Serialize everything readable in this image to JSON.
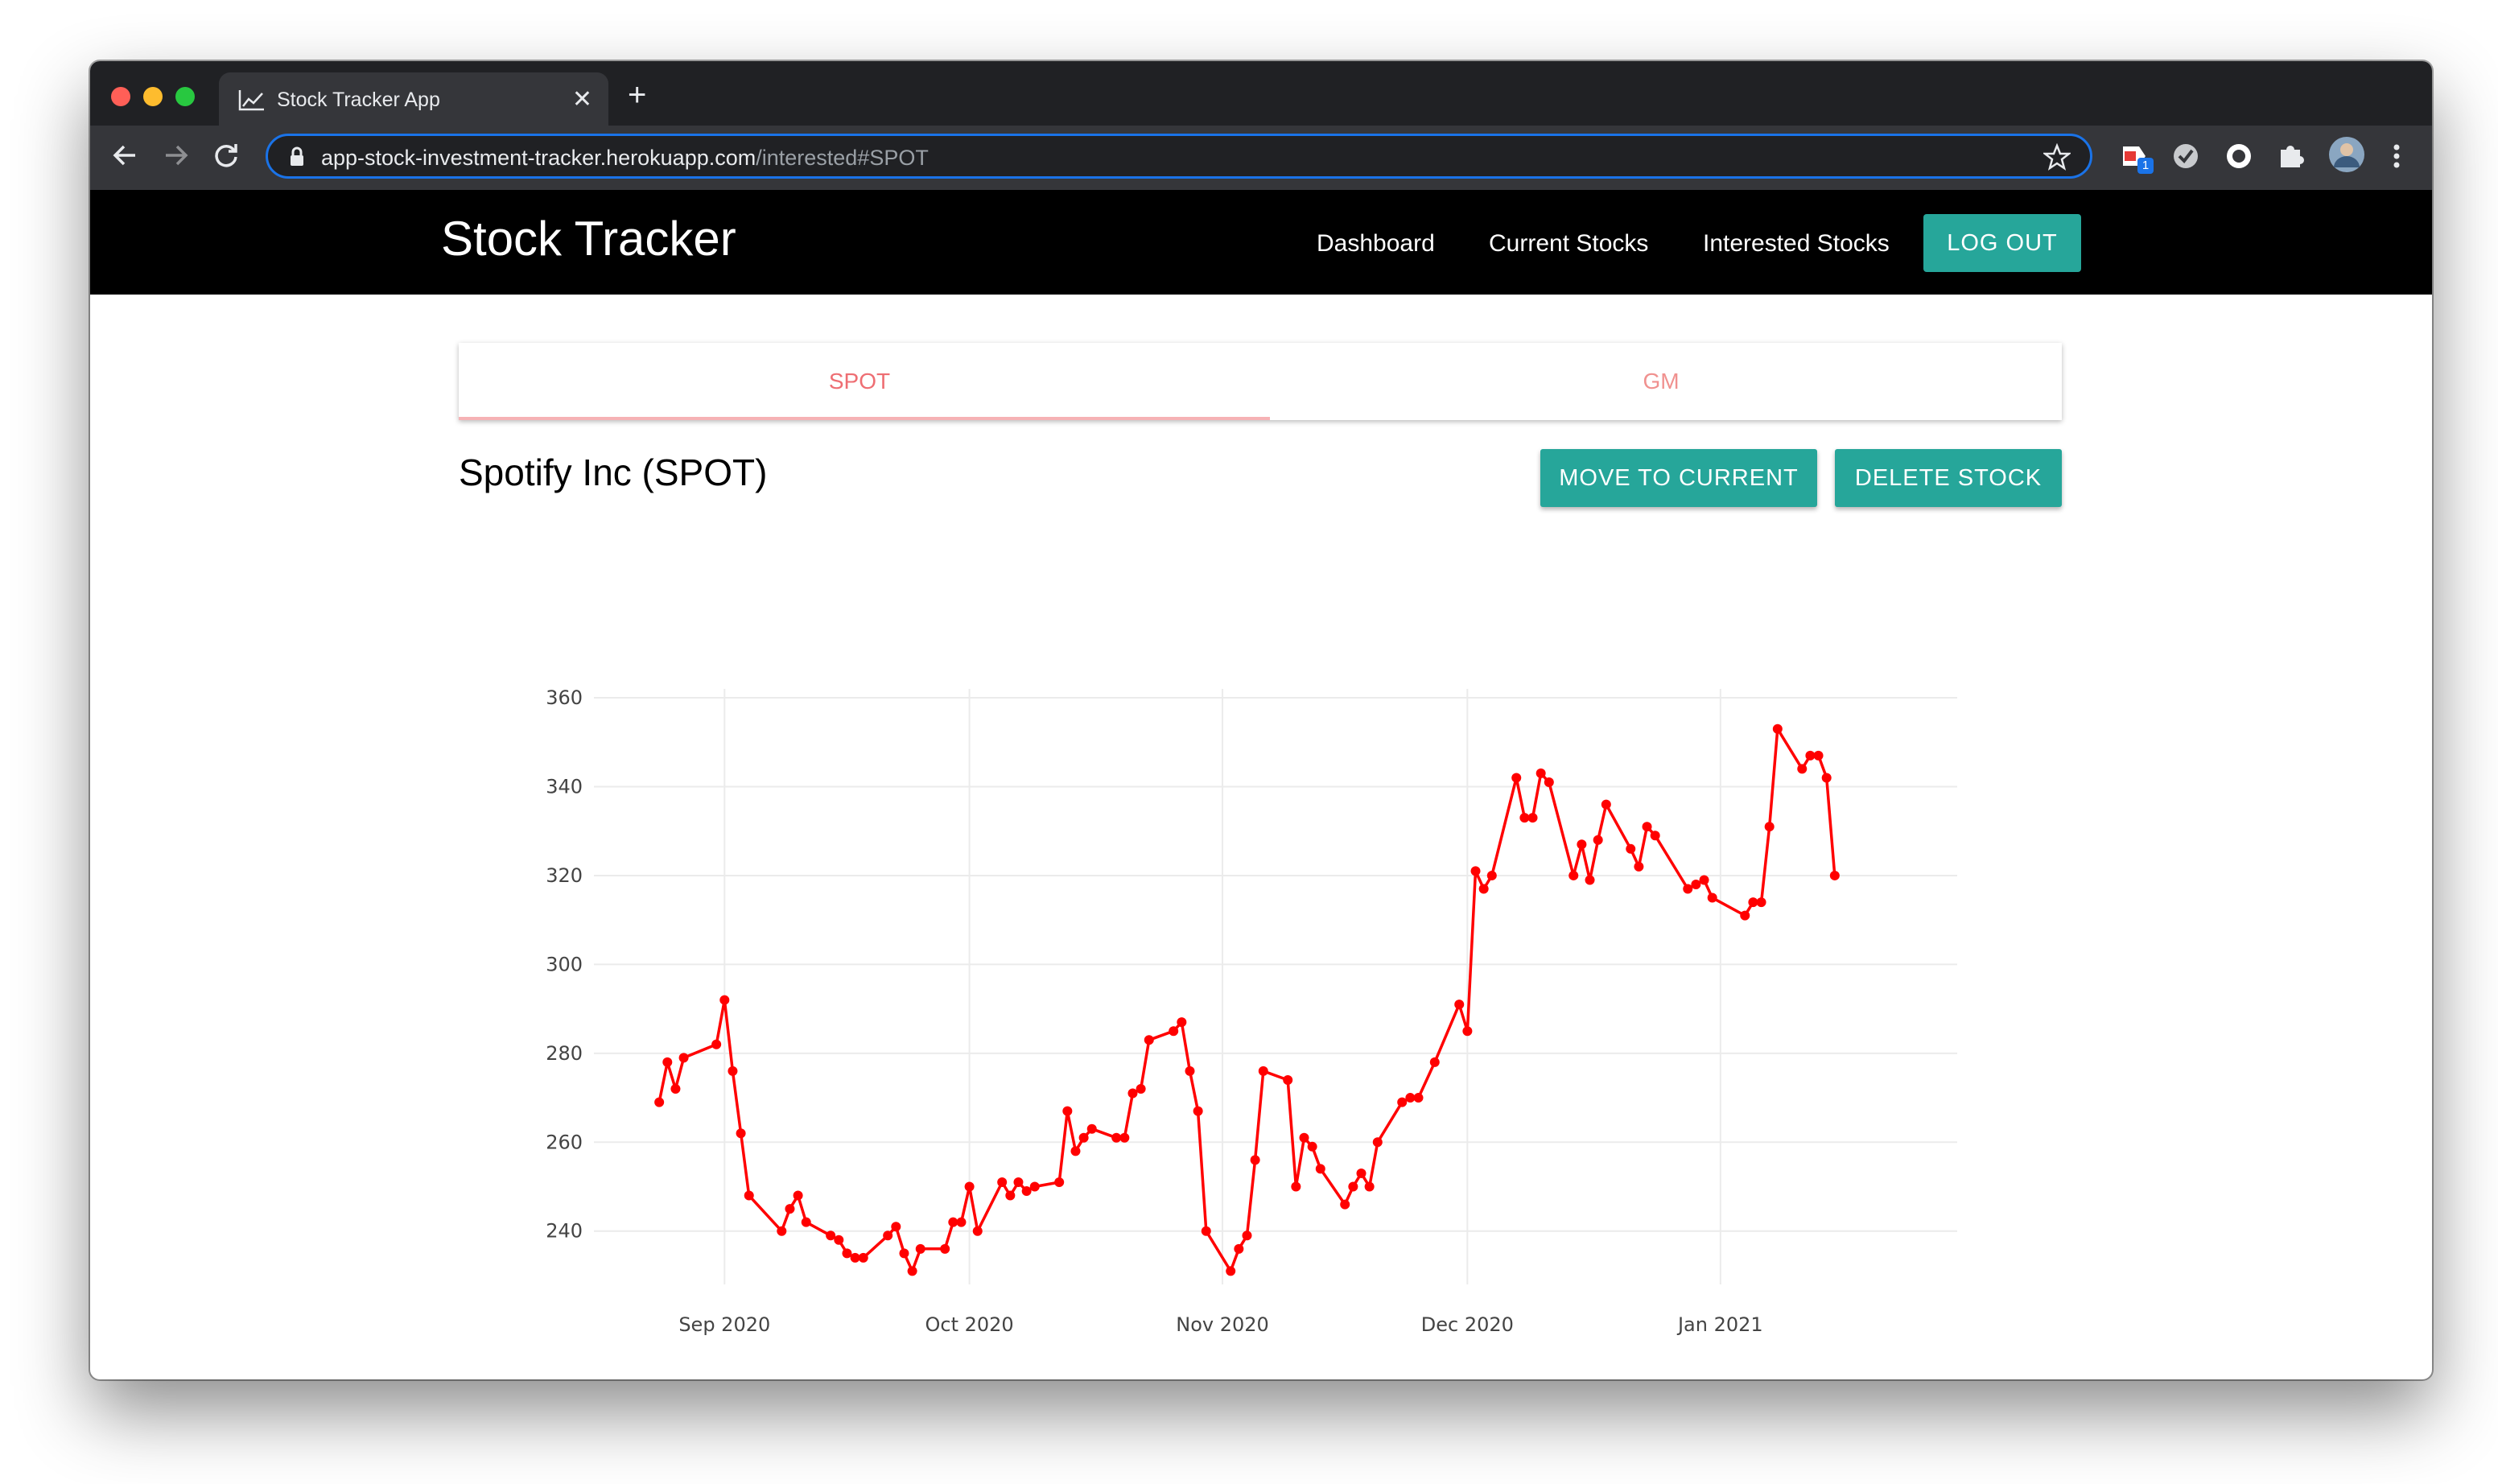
{
  "browser": {
    "tab_title": "Stock Tracker App",
    "close_glyph": "✕",
    "new_tab_glyph": "+",
    "url_host": "app-stock-investment-tracker.herokuapp.com",
    "url_path": "/interested#SPOT",
    "extension_badge": "1"
  },
  "app": {
    "brand": "Stock Tracker",
    "nav": [
      "Dashboard",
      "Current Stocks",
      "Interested Stocks"
    ],
    "logout_label": "LOG OUT",
    "accent_color": "#26a69a"
  },
  "tabs": [
    {
      "label": "SPOT",
      "active": true
    },
    {
      "label": "GM",
      "active": false
    }
  ],
  "stock": {
    "title": "Spotify Inc (SPOT)",
    "move_label": "MOVE TO CURRENT",
    "delete_label": "DELETE STOCK"
  },
  "chart_data": {
    "type": "line",
    "line_color": "#ff0000",
    "markers": true,
    "grid": true,
    "ylim": [
      228,
      362
    ],
    "xlim": [
      "2020-08-16",
      "2021-01-30"
    ],
    "yticks": [
      240,
      260,
      280,
      300,
      320,
      340,
      360
    ],
    "xticks": [
      {
        "date": "2020-09-01",
        "label": "Sep 2020"
      },
      {
        "date": "2020-10-01",
        "label": "Oct 2020"
      },
      {
        "date": "2020-11-01",
        "label": "Nov 2020"
      },
      {
        "date": "2020-12-01",
        "label": "Dec 2020"
      },
      {
        "date": "2021-01-01",
        "label": "Jan 2021"
      }
    ],
    "series": [
      {
        "points": [
          [
            "2020-08-24",
            269
          ],
          [
            "2020-08-25",
            278
          ],
          [
            "2020-08-26",
            272
          ],
          [
            "2020-08-27",
            279
          ],
          [
            "2020-08-31",
            282
          ],
          [
            "2020-09-01",
            292
          ],
          [
            "2020-09-02",
            276
          ],
          [
            "2020-09-03",
            262
          ],
          [
            "2020-09-04",
            248
          ],
          [
            "2020-09-08",
            240
          ],
          [
            "2020-09-09",
            245
          ],
          [
            "2020-09-10",
            248
          ],
          [
            "2020-09-11",
            242
          ],
          [
            "2020-09-14",
            239
          ],
          [
            "2020-09-15",
            238
          ],
          [
            "2020-09-16",
            235
          ],
          [
            "2020-09-17",
            234
          ],
          [
            "2020-09-18",
            234
          ],
          [
            "2020-09-21",
            239
          ],
          [
            "2020-09-22",
            241
          ],
          [
            "2020-09-23",
            235
          ],
          [
            "2020-09-24",
            231
          ],
          [
            "2020-09-25",
            236
          ],
          [
            "2020-09-28",
            236
          ],
          [
            "2020-09-29",
            242
          ],
          [
            "2020-09-30",
            242
          ],
          [
            "2020-10-01",
            250
          ],
          [
            "2020-10-02",
            240
          ],
          [
            "2020-10-05",
            251
          ],
          [
            "2020-10-06",
            248
          ],
          [
            "2020-10-07",
            251
          ],
          [
            "2020-10-08",
            249
          ],
          [
            "2020-10-09",
            250
          ],
          [
            "2020-10-12",
            251
          ],
          [
            "2020-10-13",
            267
          ],
          [
            "2020-10-14",
            258
          ],
          [
            "2020-10-15",
            261
          ],
          [
            "2020-10-16",
            263
          ],
          [
            "2020-10-19",
            261
          ],
          [
            "2020-10-20",
            261
          ],
          [
            "2020-10-21",
            271
          ],
          [
            "2020-10-22",
            272
          ],
          [
            "2020-10-23",
            283
          ],
          [
            "2020-10-26",
            285
          ],
          [
            "2020-10-27",
            287
          ],
          [
            "2020-10-28",
            276
          ],
          [
            "2020-10-29",
            267
          ],
          [
            "2020-10-30",
            240
          ],
          [
            "2020-11-02",
            231
          ],
          [
            "2020-11-03",
            236
          ],
          [
            "2020-11-04",
            239
          ],
          [
            "2020-11-05",
            256
          ],
          [
            "2020-11-06",
            276
          ],
          [
            "2020-11-09",
            274
          ],
          [
            "2020-11-10",
            250
          ],
          [
            "2020-11-11",
            261
          ],
          [
            "2020-11-12",
            259
          ],
          [
            "2020-11-13",
            254
          ],
          [
            "2020-11-16",
            246
          ],
          [
            "2020-11-17",
            250
          ],
          [
            "2020-11-18",
            253
          ],
          [
            "2020-11-19",
            250
          ],
          [
            "2020-11-20",
            260
          ],
          [
            "2020-11-23",
            269
          ],
          [
            "2020-11-24",
            270
          ],
          [
            "2020-11-25",
            270
          ],
          [
            "2020-11-27",
            278
          ],
          [
            "2020-11-30",
            291
          ],
          [
            "2020-12-01",
            285
          ],
          [
            "2020-12-02",
            321
          ],
          [
            "2020-12-03",
            317
          ],
          [
            "2020-12-04",
            320
          ],
          [
            "2020-12-07",
            342
          ],
          [
            "2020-12-08",
            333
          ],
          [
            "2020-12-09",
            333
          ],
          [
            "2020-12-10",
            343
          ],
          [
            "2020-12-11",
            341
          ],
          [
            "2020-12-14",
            320
          ],
          [
            "2020-12-15",
            327
          ],
          [
            "2020-12-16",
            319
          ],
          [
            "2020-12-17",
            328
          ],
          [
            "2020-12-18",
            336
          ],
          [
            "2020-12-21",
            326
          ],
          [
            "2020-12-22",
            322
          ],
          [
            "2020-12-23",
            331
          ],
          [
            "2020-12-24",
            329
          ],
          [
            "2020-12-28",
            317
          ],
          [
            "2020-12-29",
            318
          ],
          [
            "2020-12-30",
            319
          ],
          [
            "2020-12-31",
            315
          ],
          [
            "2021-01-04",
            311
          ],
          [
            "2021-01-05",
            314
          ],
          [
            "2021-01-06",
            314
          ],
          [
            "2021-01-07",
            331
          ],
          [
            "2021-01-08",
            353
          ],
          [
            "2021-01-11",
            344
          ],
          [
            "2021-01-12",
            347
          ],
          [
            "2021-01-13",
            347
          ],
          [
            "2021-01-14",
            342
          ],
          [
            "2021-01-15",
            320
          ]
        ]
      }
    ]
  }
}
